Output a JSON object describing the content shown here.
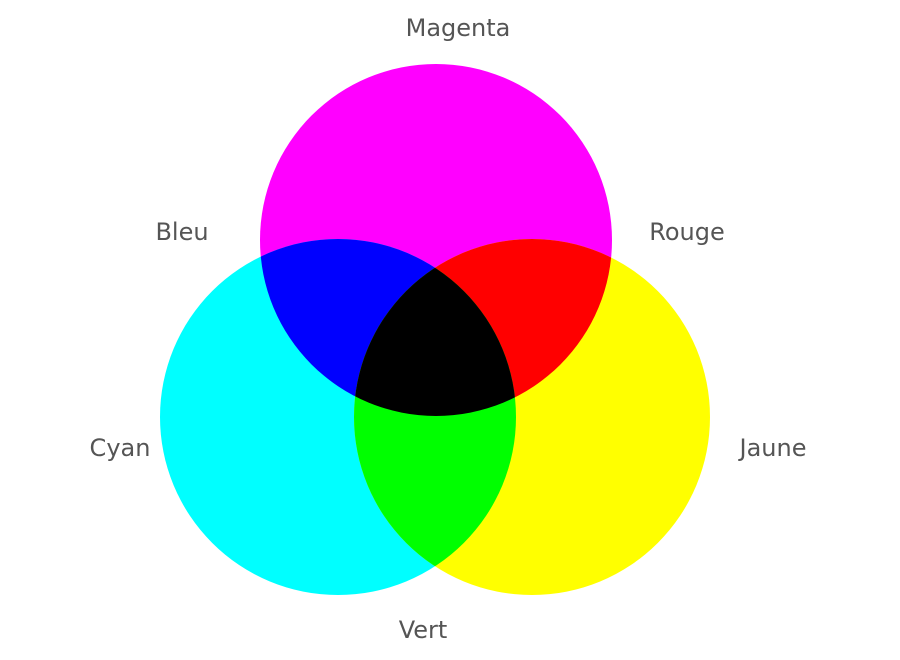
{
  "diagram": {
    "primaries": [
      {
        "id": "magenta",
        "label": "Magenta",
        "color": "#ff00ff"
      },
      {
        "id": "cyan",
        "label": "Cyan",
        "color": "#00ffff"
      },
      {
        "id": "jaune",
        "label": "Jaune",
        "color": "#ffff00"
      }
    ],
    "mixes": [
      {
        "id": "bleu",
        "label": "Bleu",
        "color": "#0000ff",
        "of": [
          "magenta",
          "cyan"
        ]
      },
      {
        "id": "rouge",
        "label": "Rouge",
        "color": "#ff0000",
        "of": [
          "magenta",
          "jaune"
        ]
      },
      {
        "id": "vert",
        "label": "Vert",
        "color": "#00ff00",
        "of": [
          "cyan",
          "jaune"
        ]
      }
    ],
    "center_color": "#000000",
    "label_color": "#555555"
  }
}
